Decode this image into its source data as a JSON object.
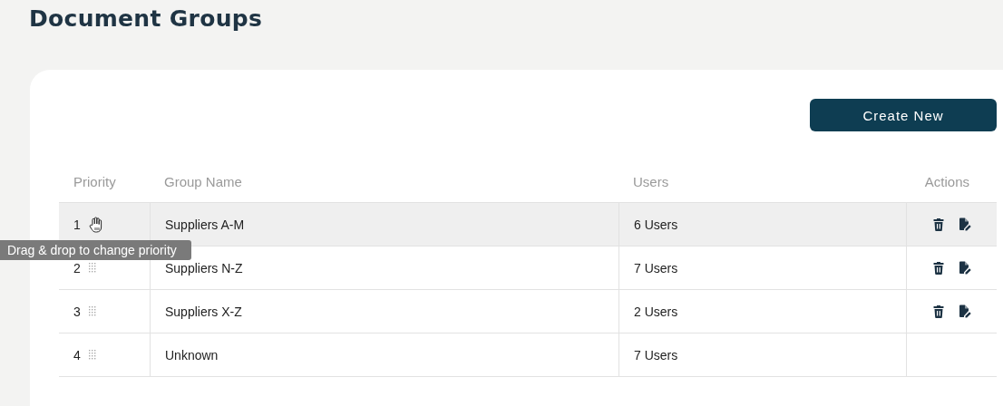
{
  "page": {
    "title": "Document Groups"
  },
  "create_button": {
    "label": "Create New"
  },
  "table": {
    "columns": [
      "Priority",
      "Group Name",
      "Users",
      "Actions"
    ],
    "rows": [
      {
        "priority": "1",
        "name": "Suppliers A-M",
        "users": "6 Users",
        "hovered": true,
        "has_actions": true
      },
      {
        "priority": "2",
        "name": "Suppliers N-Z",
        "users": "7 Users",
        "hovered": false,
        "has_actions": true
      },
      {
        "priority": "3",
        "name": "Suppliers X-Z",
        "users": "2 Users",
        "hovered": false,
        "has_actions": true
      },
      {
        "priority": "4",
        "name": "Unknown",
        "users": "7 Users",
        "hovered": false,
        "has_actions": false
      }
    ]
  },
  "tooltip": {
    "text": "Drag & drop to change priority"
  }
}
